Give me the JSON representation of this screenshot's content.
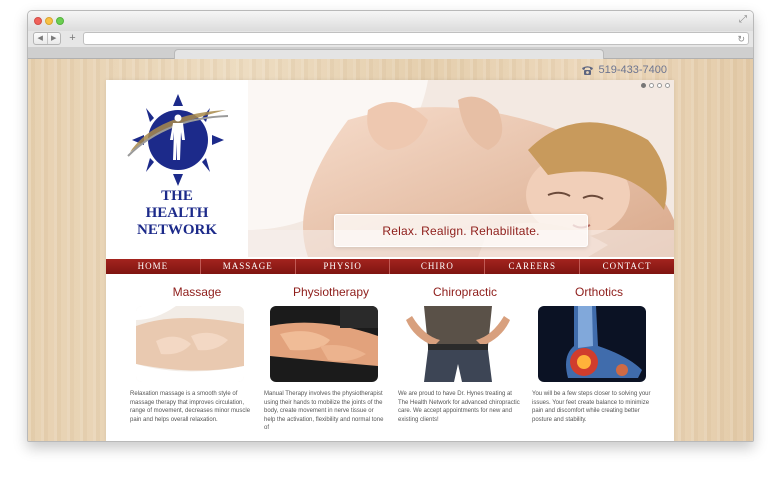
{
  "browser": {
    "nav_back": "◀",
    "nav_forward": "▶",
    "new_tab": "+",
    "reload": "↻",
    "expand": "⤢"
  },
  "site": {
    "phone": "519-433-7400",
    "logo": {
      "line1": "THE",
      "line2": "HEALTH",
      "line3": "NETWORK"
    },
    "hero": {
      "tagline": "Relax. Realign. Rehabilitate.",
      "slides": 4,
      "active_slide": 1
    },
    "nav": [
      "HOME",
      "MASSAGE",
      "PHYSIO",
      "CHIRO",
      "CAREERS",
      "CONTACT"
    ],
    "services": [
      {
        "title": "Massage",
        "text": "Relaxation massage is a smooth style of massage therapy that improves circulation, range of movement, decreases minor muscle pain and helps overall relaxation."
      },
      {
        "title": "Physiotherapy",
        "text": "Manual Therapy involves the physiotherapist using their hands to mobilize the joints of the body, create movement in nerve tissue or help the activation, flexibility and normal tone of"
      },
      {
        "title": "Chiropractic",
        "text": "We are proud to have Dr. Hynes treating at The Health Network for advanced chiropractic care. We accept appointments for new and existing clients!"
      },
      {
        "title": "Orthotics",
        "text": "You will be a few steps closer to solving your issues. Your feet create balance to minimize pain and discomfort while creating better posture and stability."
      }
    ]
  },
  "colors": {
    "brand_red": "#8e1d1a",
    "logo_blue": "#1c2a8a",
    "phone_blue": "#6d7590"
  }
}
